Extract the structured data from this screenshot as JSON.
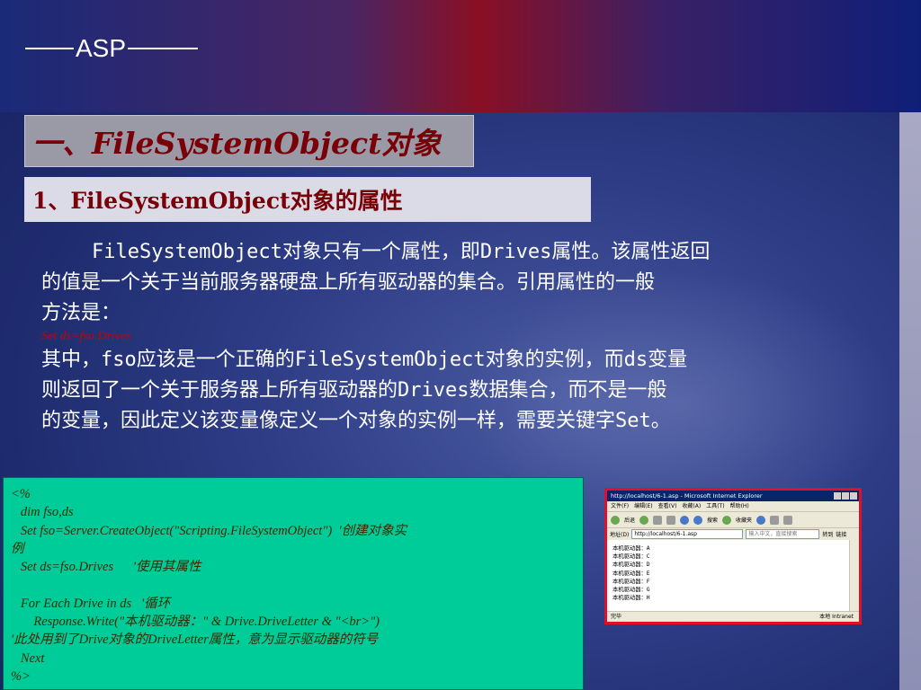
{
  "header": {
    "title": "ASP"
  },
  "section": {
    "title": "一、FileSystemObject对象"
  },
  "subsection": {
    "title": "1、FileSystemObject对象的属性"
  },
  "body": {
    "line1": "FileSystemObject对象只有一个属性，即Drives属性。该属性返回",
    "line2": "的值是一个关于当前服务器硬盘上所有驱动器的集合。引用属性的一般",
    "line3": "方法是：",
    "code": "Set ds=fso.Drives",
    "line4": "其中，fso应该是一个正确的FileSystemObject对象的实例，而ds变量",
    "line5": "则返回了一个关于服务器上所有驱动器的Drives数据集合，而不是一般",
    "line6": "的变量，因此定义该变量像定义一个对象的实例一样，需要关键字Set。"
  },
  "code_listing": {
    "lines": [
      "<%",
      "   dim fso,ds",
      "   Set fso=Server.CreateObject(\"Scripting.FileSystemObject\")  '创建对象实",
      "例",
      "   Set ds=fso.Drives      '使用其属性",
      "",
      "   For Each Drive in ds   '循环",
      "       Response.Write(\"本机驱动器：\" & Drive.DriveLetter & \"<br>\")",
      "'此处用到了Drive对象的DriveLetter属性，意为显示驱动器的符号",
      "   Next",
      "%>"
    ]
  },
  "browser_shot": {
    "window_title": "http://localhost/6-1.asp - Microsoft Internet Explorer",
    "menu": [
      "文件(F)",
      "编辑(E)",
      "查看(V)",
      "收藏(A)",
      "工具(T)",
      "帮助(H)"
    ],
    "toolbar": {
      "back": "后退",
      "search": "搜索",
      "favorites": "收藏夹"
    },
    "address_label": "地址(D)",
    "address": "http://localhost/6-1.asp",
    "search_placeholder": "输入中文，直接搜索",
    "goto": "转到",
    "links": "链接",
    "output_lines": [
      "本机驱动器：A",
      "本机驱动器：C",
      "本机驱动器：D",
      "本机驱动器：E",
      "本机驱动器：F",
      "本机驱动器：G",
      "本机驱动器：H"
    ],
    "status_left": "完毕",
    "status_zone": "本地 Intranet"
  },
  "colors": {
    "heading_red": "#7a0008",
    "code_red": "#cc0000",
    "code_box": "#00cc99",
    "frame_red": "#e0102a"
  }
}
